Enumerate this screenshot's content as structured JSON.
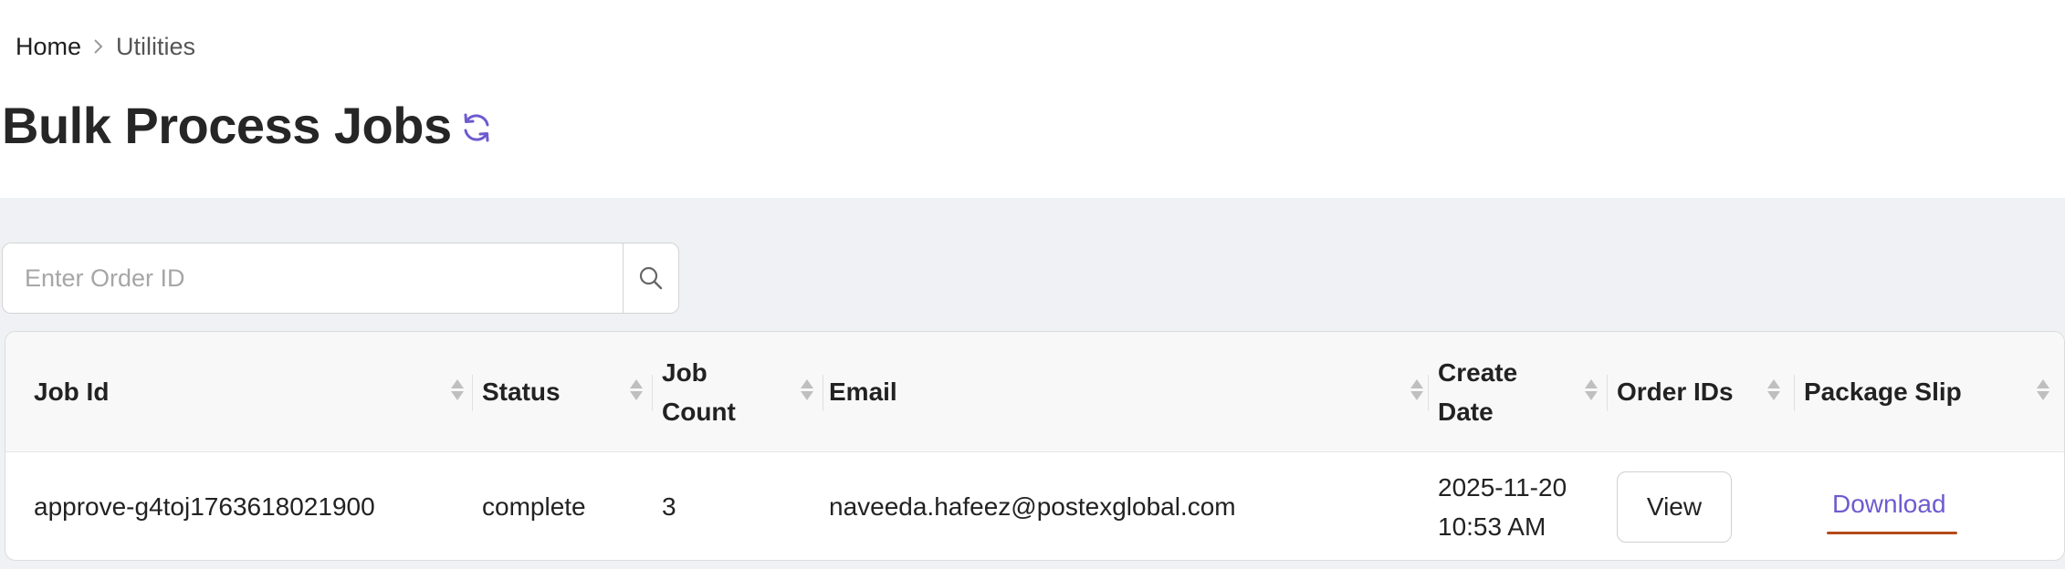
{
  "breadcrumb": {
    "home": "Home",
    "current": "Utilities"
  },
  "page": {
    "title": "Bulk Process Jobs"
  },
  "search": {
    "placeholder": "Enter Order ID",
    "value": ""
  },
  "table": {
    "columns": [
      "Job Id",
      "Status",
      "Job Count",
      "Email",
      "Create Date",
      "Order IDs",
      "Package Slip"
    ],
    "rows": [
      {
        "job_id": "approve-g4toj1763618021900",
        "status": "complete",
        "job_count": "3",
        "email": "naveeda.hafeez@postexglobal.com",
        "create_date": "2025-11-20",
        "create_time": "10:53 AM",
        "order_ids_action": "View",
        "package_slip_action": "Download"
      }
    ]
  },
  "colors": {
    "accent": "#6d5bd0",
    "content_bg": "#eff1f4",
    "link_underline": "#b54a1a"
  },
  "icons": {
    "refresh": "refresh-icon",
    "search": "search-icon",
    "breadcrumb_separator": "chevron-right-icon",
    "sort": "sort-icon"
  }
}
